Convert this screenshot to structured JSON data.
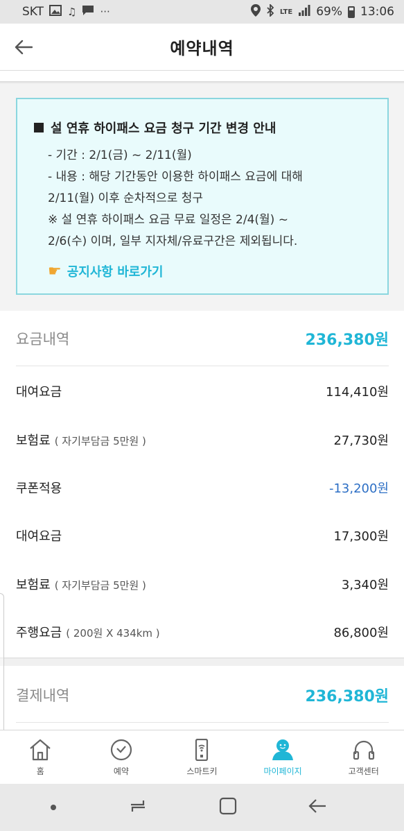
{
  "status_bar": {
    "carrier": "SKT",
    "network": "LTE",
    "battery": "69%",
    "time": "13:06"
  },
  "header": {
    "title": "예약내역"
  },
  "notice": {
    "title": "설 연휴 하이패스 요금 청구 기간 변경 안내",
    "lines": [
      "- 기간 : 2/1(금) ~ 2/11(월)",
      "- 내용 : 해당 기간동안 이용한 하이패스 요금에 대해",
      "2/11(월) 이후 순차적으로 청구",
      "※ 설 연휴 하이패스 요금 무료 일정은 2/4(월) ~",
      "2/6(수) 이며, 일부 지자체/유료구간은 제외됩니다."
    ],
    "link_label": "공지사항 바로가기"
  },
  "fees": {
    "total_label": "요금내역",
    "total_value": "236,380원",
    "items": [
      {
        "label": "대여요금",
        "sub": "",
        "value": "114,410원"
      },
      {
        "label": "보험료",
        "sub": "( 자기부담금 5만원 )",
        "value": "27,730원"
      },
      {
        "label": "쿠폰적용",
        "sub": "",
        "value": "-13,200원"
      },
      {
        "label": "대여요금",
        "sub": "",
        "value": "17,300원"
      },
      {
        "label": "보험료",
        "sub": "( 자기부담금 5만원 )",
        "value": "3,340원"
      },
      {
        "label": "주행요금",
        "sub": "( 200원 X 434km )",
        "value": "86,800원"
      }
    ]
  },
  "payment": {
    "total_label": "결제내역",
    "total_value": "236,380원"
  },
  "tabs": [
    {
      "label": "홈",
      "icon": "home-icon"
    },
    {
      "label": "예약",
      "icon": "check-circle-icon"
    },
    {
      "label": "스마트키",
      "icon": "smartkey-icon"
    },
    {
      "label": "마이페이지",
      "icon": "person-icon",
      "active": true
    },
    {
      "label": "고객센터",
      "icon": "headset-icon"
    }
  ],
  "colors": {
    "accent": "#20b6d6",
    "negative": "#2d6fc5",
    "notice_bg": "#e9fbfc",
    "notice_border": "#8ad6df"
  }
}
